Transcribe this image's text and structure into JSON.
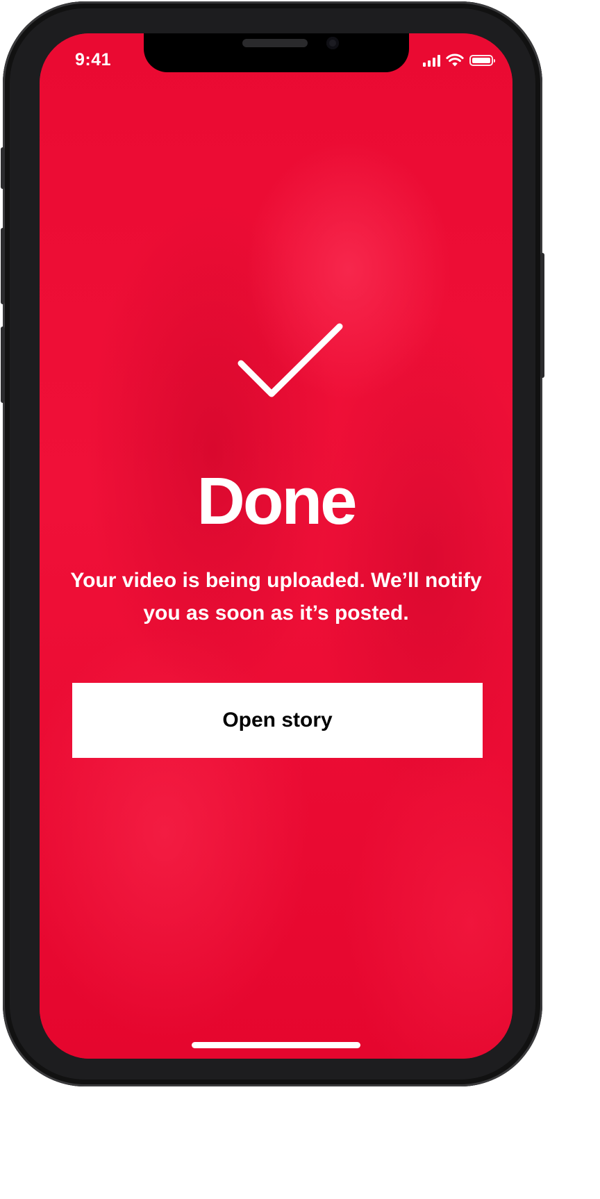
{
  "status_bar": {
    "time": "9:41",
    "icons": [
      "cellular-signal-icon",
      "wifi-icon",
      "battery-icon"
    ],
    "battery_level": 1.0
  },
  "confirmation": {
    "icon": "checkmark-icon",
    "title": "Done",
    "message": "Your video is being uploaded. We’ll notify you as soon as it’s posted."
  },
  "actions": {
    "open_story_label": "Open story"
  },
  "colors": {
    "background": "#e8092f",
    "text": "#ffffff",
    "button_background": "#ffffff",
    "button_text": "#000000",
    "device_frame": "#1d1d1f"
  }
}
